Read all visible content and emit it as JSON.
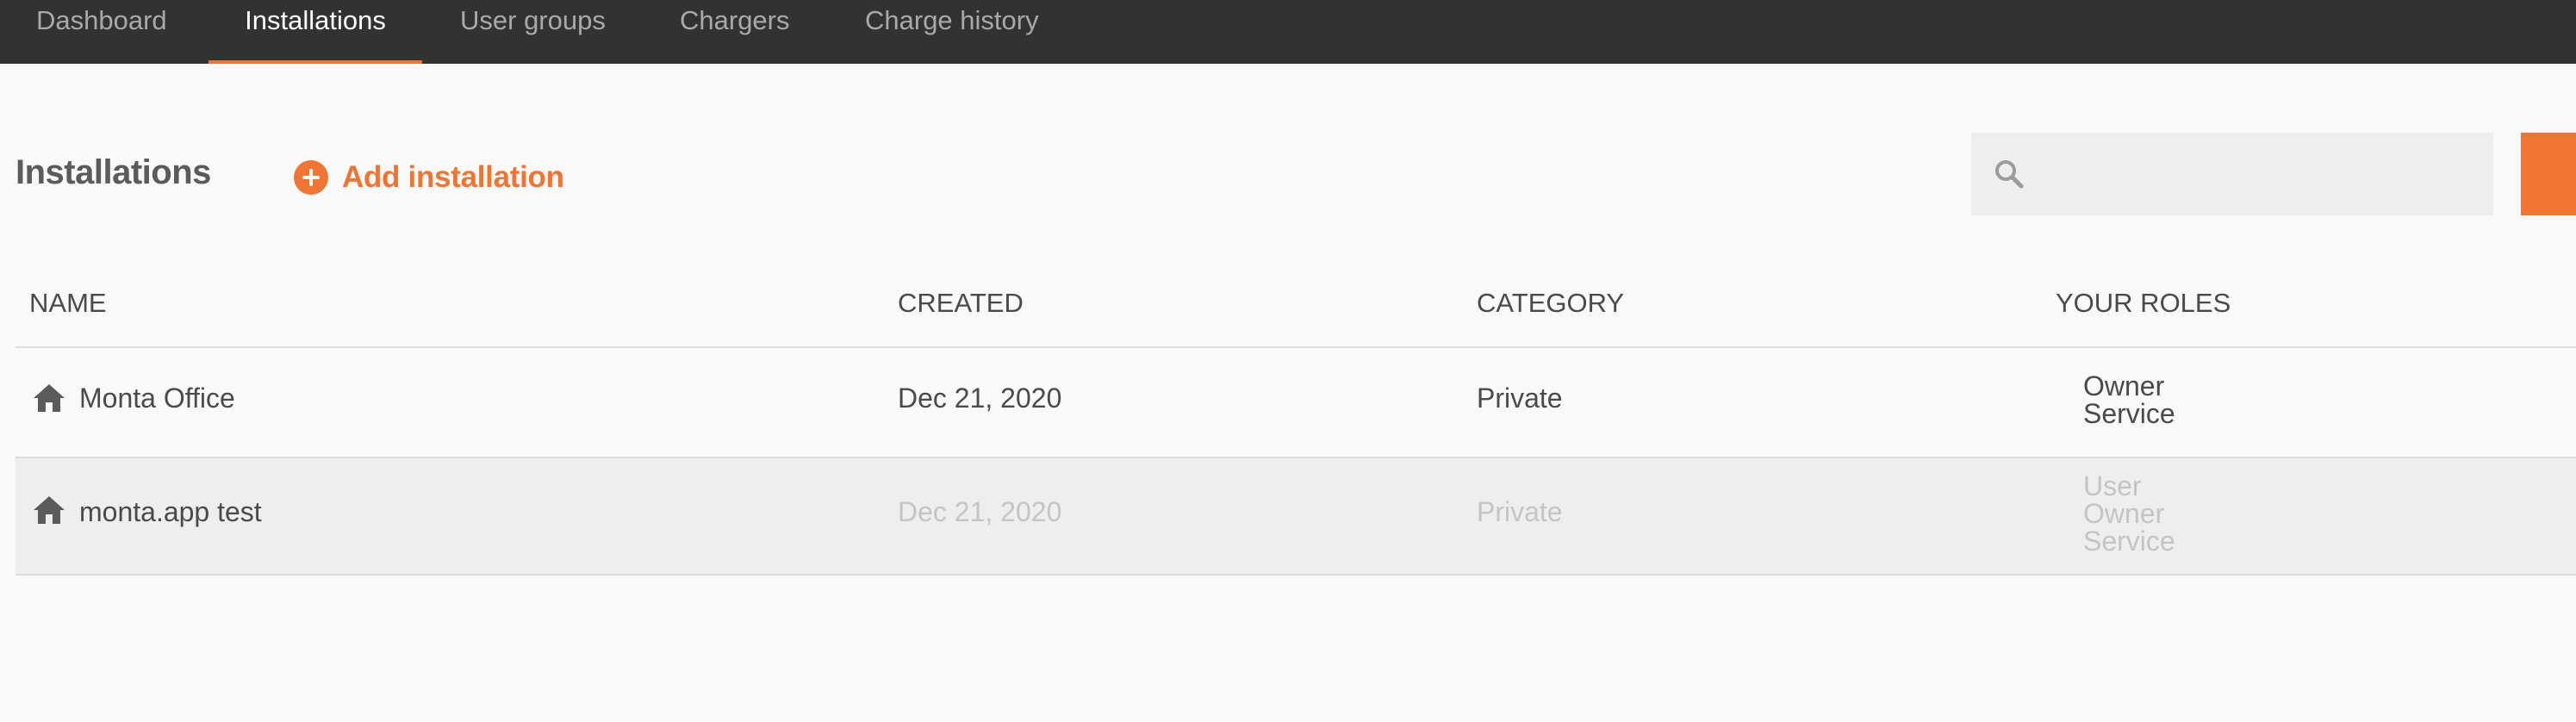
{
  "nav": {
    "tabs": [
      {
        "label": "Dashboard",
        "active": false
      },
      {
        "label": "Installations",
        "active": true
      },
      {
        "label": "User groups",
        "active": false
      },
      {
        "label": "Chargers",
        "active": false
      },
      {
        "label": "Charge history",
        "active": false
      }
    ]
  },
  "header": {
    "title": "Installations",
    "add_label": "Add installation",
    "add_icon": "plus-circle-icon"
  },
  "search": {
    "placeholder": "",
    "value": "",
    "icon": "search-icon"
  },
  "table": {
    "columns": [
      "NAME",
      "CREATED",
      "CATEGORY",
      "YOUR ROLES"
    ],
    "rows": [
      {
        "icon": "home-icon",
        "name": "Monta Office",
        "created": "Dec 21, 2020",
        "category": "Private",
        "roles": [
          "Owner",
          "Service"
        ]
      },
      {
        "icon": "home-icon",
        "name": "monta.app test",
        "created": "Dec 21, 2020",
        "category": "Private",
        "roles": [
          "User",
          "Owner",
          "Service"
        ]
      }
    ]
  },
  "colors": {
    "accent": "#f07432",
    "nav_background": "#323232",
    "page_background": "#f9f9f9",
    "selected_row": "#eeeeee"
  }
}
